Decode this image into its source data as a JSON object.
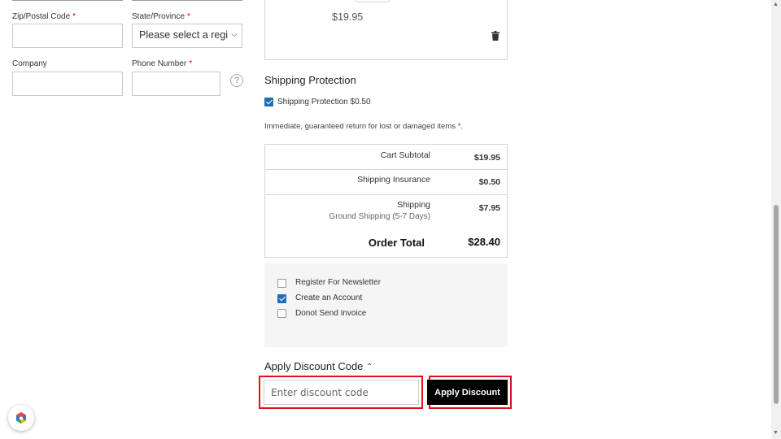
{
  "address_form": {
    "zip": {
      "label": "Zip/Postal Code",
      "required_mark": "*",
      "value": ""
    },
    "state": {
      "label": "State/Province",
      "required_mark": "*",
      "selected": "Please select a regi"
    },
    "company": {
      "label": "Company",
      "value": ""
    },
    "phone": {
      "label": "Phone Number",
      "required_mark": "*",
      "value": "",
      "help_glyph": "?"
    }
  },
  "cart_item": {
    "price": "$19.95",
    "remove_icon": "trash-icon"
  },
  "shipping_protection": {
    "title": "Shipping Protection",
    "checkbox_label": "Shipping Protection $0.50",
    "checked": true,
    "note": "Immediate, guaranteed return for lost or damaged items *."
  },
  "totals": {
    "subtotal": {
      "label": "Cart Subtotal",
      "value": "$19.95"
    },
    "insurance": {
      "label": "Shipping Insurance",
      "value": "$0.50"
    },
    "shipping": {
      "label": "Shipping",
      "method": "Ground Shipping (5-7 Days)",
      "value": "$7.95"
    },
    "order_total": {
      "label": "Order Total",
      "value": "$28.40"
    }
  },
  "options": [
    {
      "label": "Register For Newsletter",
      "checked": false
    },
    {
      "label": "Create an Account",
      "checked": true
    },
    {
      "label": "Donot Send Invoice",
      "checked": false
    }
  ],
  "discount": {
    "title": "Apply Discount Code",
    "placeholder": "Enter discount code",
    "button_label": "Apply Discount"
  },
  "colors": {
    "accent": "#1f6fb5",
    "required": "#d0021b",
    "highlight": "#e0101d",
    "button_bg": "#000000"
  }
}
